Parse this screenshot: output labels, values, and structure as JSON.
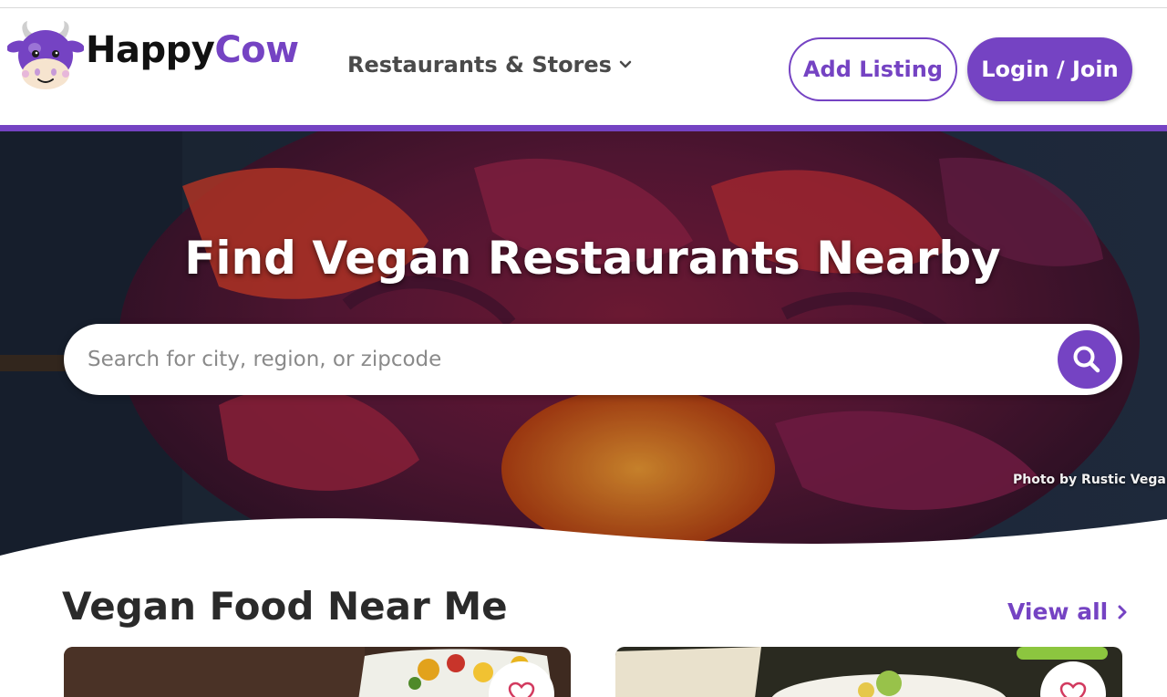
{
  "brand": {
    "name_part1": "Happy",
    "name_part2": "Cow",
    "logo_icon": "cow-mascot-icon",
    "accent_color": "#7543c3"
  },
  "nav": {
    "dropdown_label": "Restaurants & Stores",
    "dropdown_icon": "chevron-down-icon"
  },
  "header_actions": {
    "add_listing": "Add Listing",
    "login_join": "Login / Join"
  },
  "hero": {
    "title": "Find Vegan Restaurants Nearby",
    "search_placeholder": "Search for city, region, or zipcode",
    "search_icon": "search-icon",
    "photo_credit": "Photo by Rustic Vegan"
  },
  "section": {
    "title": "Vegan Food Near Me",
    "view_all": "View all",
    "view_all_icon": "chevron-right-icon"
  },
  "cards": [
    {
      "favorite_icon": "heart-outline-icon"
    },
    {
      "favorite_icon": "heart-outline-icon"
    }
  ]
}
